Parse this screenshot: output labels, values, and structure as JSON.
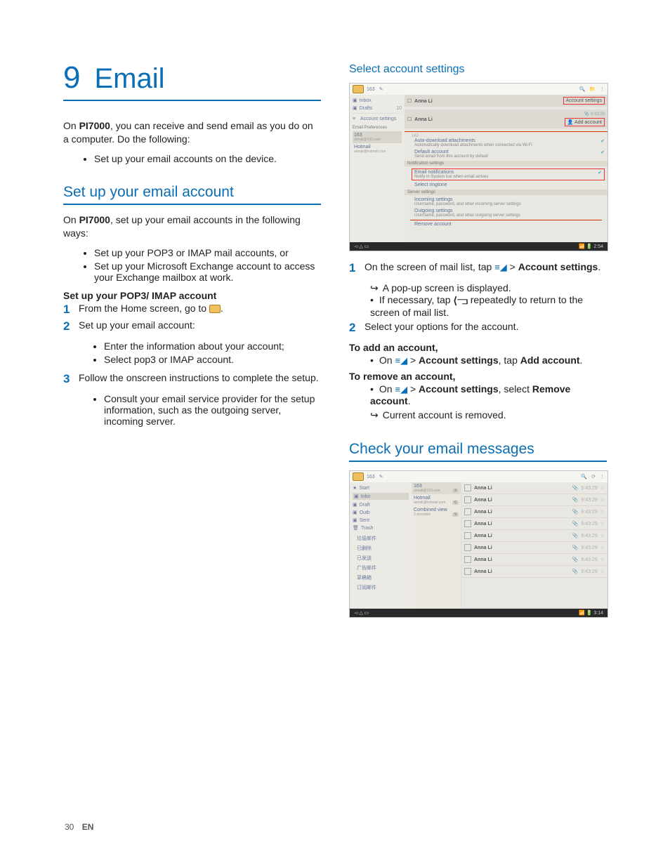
{
  "chapter": {
    "number": "9",
    "title": "Email"
  },
  "intro1": "On ",
  "product": "PI7000",
  "intro2": ", you can receive and send email as you do on a computer. Do the following:",
  "intro_bullet": "Set up your email accounts on the device.",
  "s1_h": "Set up your email account",
  "s1_p1a": "On ",
  "s1_p1b": ", set up your email accounts in the following ways:",
  "s1_b1": "Set up your POP3 or IMAP mail accounts, or",
  "s1_b2": "Set up your Microsoft Exchange account to access your Exchange mailbox at work.",
  "s1_sub": "Set up your POP3/ IMAP account",
  "s1_n1": "From the Home screen, go to ",
  "s1_n2": "Set up your email account:",
  "s1_n2_b1": "Enter the information about your account;",
  "s1_n2_b2": "Select pop3 or IMAP account.",
  "s1_n3": "Follow the onscreen instructions to complete the setup.",
  "s1_n3_b1": "Consult your email service provider for the setup information, such as the outgoing server, incoming server.",
  "s2_h": "Select account settings",
  "shot1": {
    "app": "163",
    "left": [
      [
        "★",
        "Inbox"
      ],
      [
        "▣",
        "Drafts"
      ]
    ],
    "badge": "10",
    "as": "Account settings",
    "ep": "Email Preferences",
    "acc1": [
      "163",
      "annali@163.com"
    ],
    "acc2": [
      "Hotmail",
      "annali@hotmail.com"
    ],
    "sender": "Anna Li",
    "as_btn": "Account settings",
    "addbtn": "Add account",
    "g1": [
      "Auto-download attachments",
      "Automatically download attachments when connected via Wi-Fi"
    ],
    "g2": [
      "Default account",
      "Send email from this account by default"
    ],
    "sec1": "Notification settings",
    "g3": [
      "Email notifications",
      "Notify in System bar when email arrives"
    ],
    "g4": [
      "Select ringtone",
      ""
    ],
    "sec2": "Server settings",
    "g5": [
      "Incoming settings",
      "Username, password, and other incoming server settings"
    ],
    "g6": [
      "Outgoing settings",
      "Username, password, and other outgoing server settings"
    ],
    "rm": "Remove account",
    "clk": "2:54"
  },
  "s2_n1a": "On the screen of mail list, tap ",
  "s2_n1b": " > ",
  "s2_n1c": "Account settings",
  "s2_n1d": ".",
  "s2_n1_arrow": "A pop-up screen is displayed.",
  "s2_n1_dot_a": "If necessary, tap ",
  "s2_n1_dot_b": " repeatedly to return to the screen of mail list.",
  "s2_n2": "Select your options for the account.",
  "s2_add_h": "To add an account,",
  "s2_add_a": "On ",
  "s2_add_b": " > ",
  "s2_add_c": "Account settings",
  "s2_add_d": ", tap ",
  "s2_add_e": "Add account",
  "s2_add_f": ".",
  "s2_rm_h": "To remove an account,",
  "s2_rm_a": "On ",
  "s2_rm_b": " > ",
  "s2_rm_c": "Account settings",
  "s2_rm_d": ", select ",
  "s2_rm_e": "Remove account",
  "s2_rm_f": ".",
  "s2_rm_arrow": "Current account is removed.",
  "s3_h": "Check your email messages",
  "shot2": {
    "app": "163",
    "tabs": [
      [
        "★",
        "Start"
      ],
      [
        "▣",
        "Inbo"
      ],
      [
        "▣",
        "Draft"
      ],
      [
        "▣",
        "Outb"
      ],
      [
        "▣",
        "Sent"
      ],
      [
        "🗑",
        "Trash"
      ]
    ],
    "drop": [
      [
        "163",
        "annali@163.com",
        "9"
      ],
      [
        "Hotmail",
        "annali@hotmail.com",
        "0"
      ],
      [
        "Combined view",
        "2 accounts",
        "9"
      ]
    ],
    "folders": [
      "垃圾邮件",
      "已删除",
      "已发送",
      "广告邮件",
      "草稿箱",
      "订阅邮件"
    ],
    "sender": "Anna Li",
    "times": [
      "9:43:29",
      "9:43:29",
      "9:43:29",
      "9:43:29",
      "9:43:29",
      "9:43:29",
      "9:43:29",
      "9:43:29"
    ],
    "clk": "3:14"
  },
  "page_num": "30",
  "page_lang": "EN"
}
